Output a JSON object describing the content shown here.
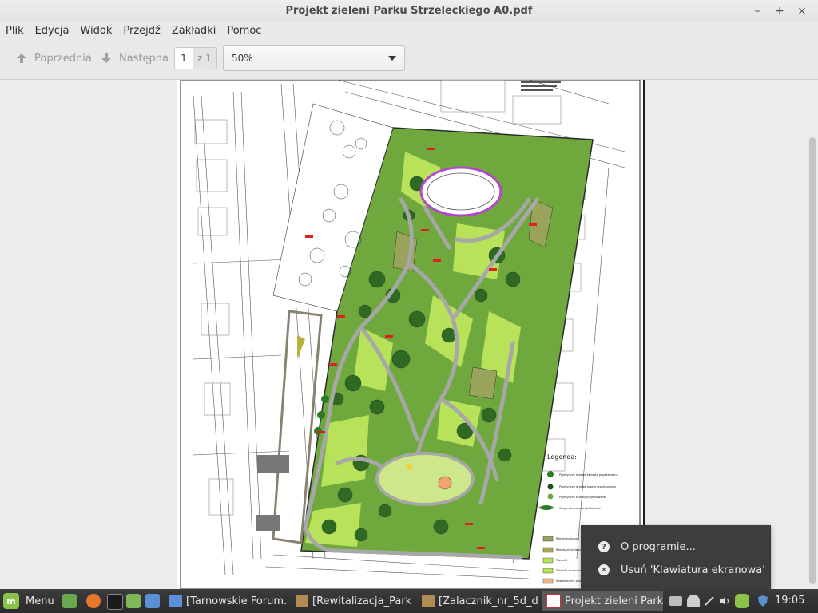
{
  "window": {
    "title": "Projekt zieleni Parku Strzeleckiego A0.pdf",
    "minimize": "–",
    "maximize": "+",
    "close": "×"
  },
  "menubar": [
    "Plik",
    "Edycja",
    "Widok",
    "Przejdź",
    "Zakładki",
    "Pomoc"
  ],
  "toolbar": {
    "prev_label": "Poprzednia",
    "next_label": "Następna",
    "page_value": "1",
    "page_total": "z 1",
    "zoom_value": "50%"
  },
  "document": {
    "legend_title": "Legenda:",
    "legend_items": [
      "Pojedyncze drzewa liściaste projektowane",
      "Pojedyncze drzewa iglaste projektowane",
      "Pojedyncze krzewy projektowane",
      "Grupy krzewów projektowane",
      "Rabaty bylinowe",
      "Rabaty zimozielone",
      "Trawniki",
      "Trawniki z cebulowymi",
      "Nawierzchnie placów"
    ]
  },
  "popup": {
    "items": [
      {
        "icon": "question-icon",
        "label": "O programie..."
      },
      {
        "icon": "remove-icon",
        "label": "Usuń 'Klawiatura ekranowa'"
      }
    ]
  },
  "taskbar": {
    "menu_label": "Menu",
    "tasks": [
      {
        "label": "[Tarnowskie Forum...",
        "icon": "browser-icon",
        "active": false
      },
      {
        "label": "[Rewitalizacja_Park...",
        "icon": "archive-icon",
        "active": false
      },
      {
        "label": "[Zalacznik_nr_5d_d...",
        "icon": "archive-icon",
        "active": false
      },
      {
        "label": "Projekt zieleni Park...",
        "icon": "pdf-icon",
        "active": true
      }
    ],
    "clock": "19:05"
  },
  "colors": {
    "titlebar": "#e6e6e6",
    "toolbar": "#e9e9e9",
    "taskbar": "#2f2f2f",
    "park_green_dark": "#3f7a2f",
    "park_green_light": "#b8e05a",
    "path_grey": "#a8a8a8",
    "popup_bg": "#3d3d3d"
  }
}
